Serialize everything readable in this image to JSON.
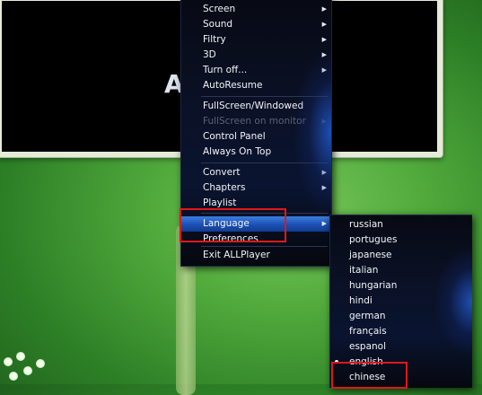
{
  "player": {
    "logo_text": "A"
  },
  "main_menu": {
    "items": [
      {
        "label": "Screen",
        "submenu": true
      },
      {
        "label": "Sound",
        "submenu": true
      },
      {
        "label": "Filtry",
        "submenu": true
      },
      {
        "label": "3D",
        "submenu": true
      },
      {
        "label": "Turn off...",
        "submenu": true
      },
      {
        "label": "AutoResume",
        "submenu": false
      },
      {
        "label": "FullScreen/Windowed",
        "submenu": false
      },
      {
        "label": "FullScreen on monitor",
        "submenu": true,
        "disabled": true
      },
      {
        "label": "Control Panel",
        "submenu": false
      },
      {
        "label": "Always On Top",
        "submenu": false
      },
      {
        "label": "Convert",
        "submenu": true
      },
      {
        "label": "Chapters",
        "submenu": true
      },
      {
        "label": "Playlist",
        "submenu": false
      },
      {
        "label": "Language",
        "submenu": true,
        "highlighted": true
      },
      {
        "label": "Preferences",
        "submenu": false
      },
      {
        "label": "Exit ALLPlayer",
        "submenu": false
      }
    ],
    "arrow_glyph": "▶"
  },
  "language_menu": {
    "items": [
      {
        "label": "russian"
      },
      {
        "label": "portugues"
      },
      {
        "label": "japanese"
      },
      {
        "label": "italian"
      },
      {
        "label": "hungarian"
      },
      {
        "label": "hindi"
      },
      {
        "label": "german"
      },
      {
        "label": "français"
      },
      {
        "label": "espanol"
      },
      {
        "label": "english",
        "selected": true
      },
      {
        "label": "chinese"
      }
    ]
  },
  "colors": {
    "highlight": "#1c4fb4",
    "annotation_box": "#e01818"
  }
}
